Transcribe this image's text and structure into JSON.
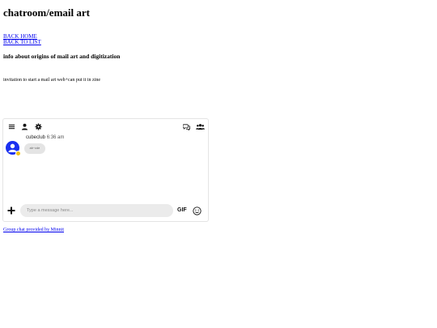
{
  "page": {
    "title": "chatroom/email art",
    "nav": {
      "back_home": "BACK HOME",
      "back_to_list": "BACK TO LIST"
    },
    "section_heading": "info about origins of mail art and digitization",
    "body_text": "invitation to start a mail art web+can put it in zine"
  },
  "chat": {
    "toolbar_icons": [
      "menu-icon",
      "user-icon",
      "gear-icon",
      "chat-bubbles-icon",
      "group-icon"
    ],
    "message": {
      "author": "cubeclub",
      "time": "6:36 am",
      "text": "ab~cde"
    },
    "composer": {
      "placeholder": "Type a message here...",
      "gif_label": "GIF"
    },
    "colors": {
      "avatar": "#1a2ff0",
      "status": "#f2c317",
      "bubble": "#e4e4e4",
      "input_bg": "#ebebeb"
    }
  },
  "footer": {
    "credit": "Group chat provided by Minnit"
  }
}
